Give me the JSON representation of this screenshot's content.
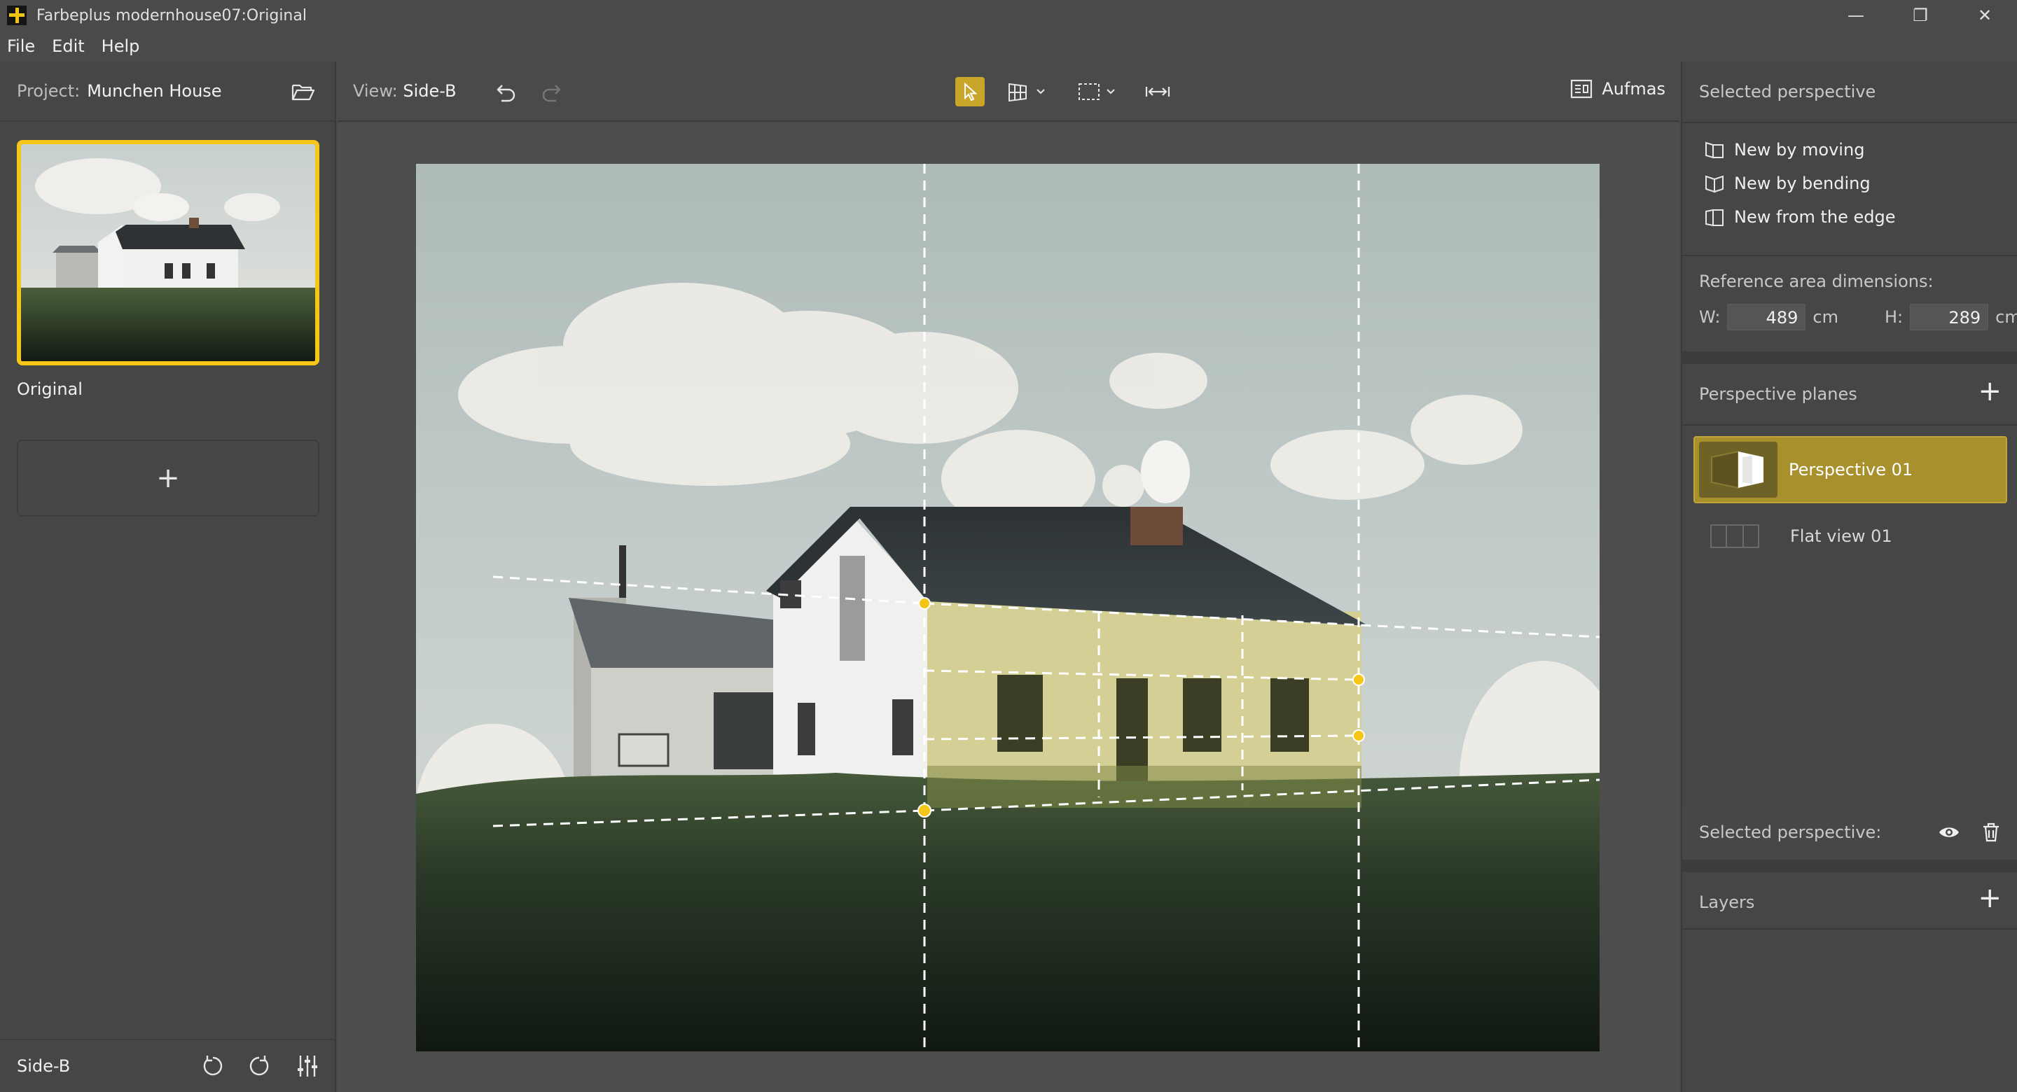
{
  "window": {
    "title": "Farbeplus modernhouse07:Original",
    "controls": [
      "—",
      "❐",
      "✕"
    ]
  },
  "menu": [
    "File",
    "Edit",
    "Help"
  ],
  "left": {
    "project_label": "Project:",
    "project_name": "Munchen House",
    "thumb_label": "Original",
    "add_symbol": "+",
    "footer_label": "Side-B"
  },
  "toolbar": {
    "view_label": "View:",
    "view_name": "Side-B",
    "aufmas_label": "Aufmas"
  },
  "right": {
    "selected_perspective_header": "Selected perspective",
    "actions": [
      "New by moving",
      "New by bending",
      "New from the edge"
    ],
    "dims_label": "Reference area dimensions:",
    "w_label": "W:",
    "w_value": "489",
    "h_label": "H:",
    "h_value": "289",
    "unit": "cm",
    "planes_header": "Perspective planes",
    "planes": [
      {
        "name": "Perspective 01",
        "selected": true
      },
      {
        "name": "Flat view 01",
        "selected": false
      }
    ],
    "selected_perspective_footer": "Selected perspective:",
    "layers_header": "Layers"
  },
  "colors": {
    "accent": "#f5c518",
    "selection_fill": "#a8902c",
    "panel_bg": "#464646"
  }
}
